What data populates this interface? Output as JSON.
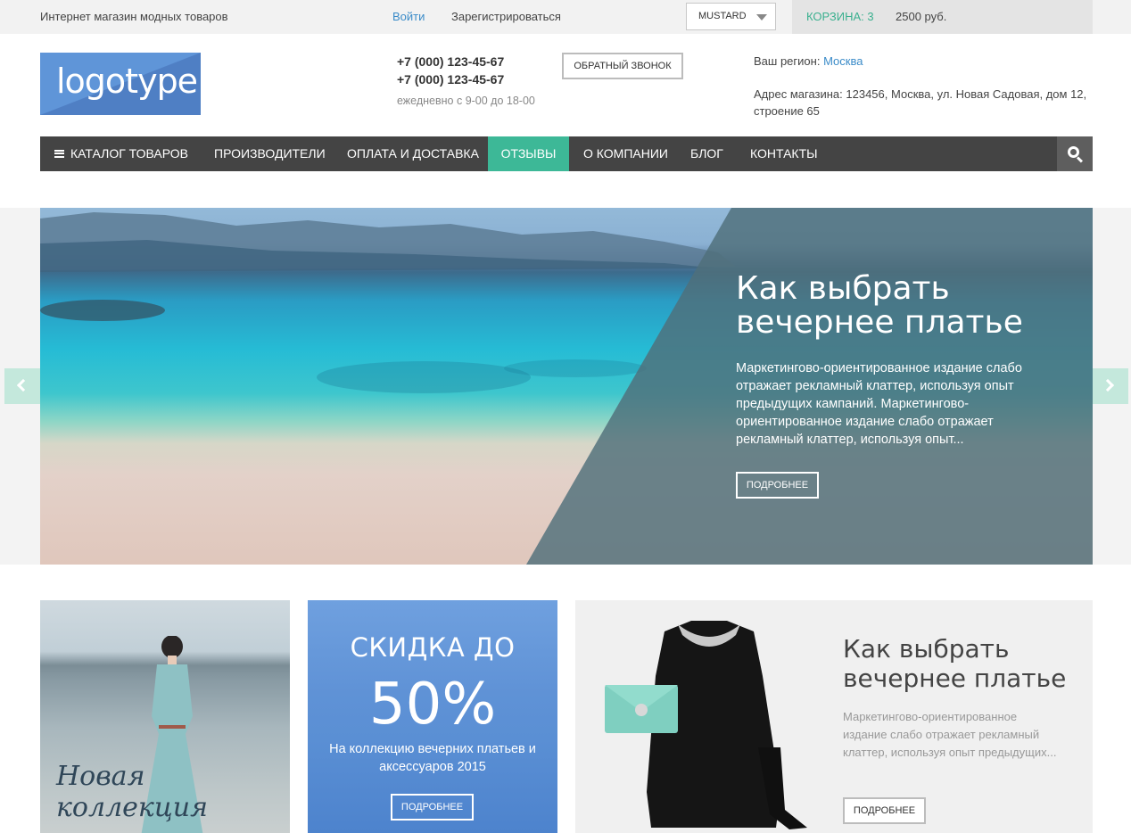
{
  "topbar": {
    "tagline": "Интернет магазин модных товаров",
    "login": "Войти",
    "register": "Зарегистрироваться",
    "theme": "MUSTARD",
    "cart_label": "КОРЗИНА: 3",
    "cart_sum": "2500 руб."
  },
  "header": {
    "logo_text": "logotype",
    "phone1": "+7 (000) 123-45-67",
    "phone2": "+7 (000) 123-45-67",
    "hours": "ежедневно с 9-00 до 18-00",
    "callback": "ОБРАТНЫЙ ЗВОНОК",
    "region_label": "Ваш регион:",
    "region_city": "Москва",
    "address": "Адрес магазина: 123456, Москва, ул. Новая Садовая, дом 12, строение 65"
  },
  "nav": {
    "items": [
      {
        "label": "КАТАЛОГ ТОВАРОВ"
      },
      {
        "label": "ПРОИЗВОДИТЕЛИ"
      },
      {
        "label": "ОПЛАТА И ДОСТАВКА"
      },
      {
        "label": "ОТЗЫВЫ"
      },
      {
        "label": "О КОМПАНИИ"
      },
      {
        "label": "БЛОГ"
      },
      {
        "label": "КОНТАКТЫ"
      }
    ],
    "active": "ОТЗЫВЫ"
  },
  "hero": {
    "title": "Как выбрать вечернее платье",
    "text": "Маркетингово-ориентированное издание слабо отражает рекламный клаттер, используя опыт предыдущих кампаний. Маркетингово-ориентированное издание слабо отражает рекламный клаттер, используя опыт...",
    "button": "ПОДРОБНЕЕ"
  },
  "cards": {
    "collection": {
      "script": "Новая коллекция"
    },
    "sale": {
      "line1": "СКИДКА ДО",
      "percent": "50%",
      "desc": "На коллекцию вечерних платьев и аксессуаров 2015",
      "button": "ПОДРОБНЕЕ"
    },
    "article": {
      "title": "Как выбрать вечернее платье",
      "desc": "Маркетингово-ориентированное издание слабо отражает рекламный клаттер, используя опыт предыдущих...",
      "button": "ПОДРОБНЕЕ"
    }
  },
  "colors": {
    "accent": "#3db897",
    "link": "#3a8bc8",
    "nav_bg": "#444444"
  }
}
